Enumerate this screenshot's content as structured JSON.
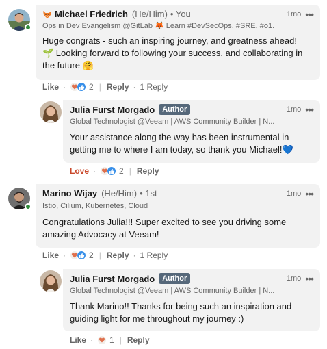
{
  "comments": [
    {
      "name": "Michael Friedrich",
      "pronouns": "(He/Him)",
      "connection": "• You",
      "headline": "Ops in Dev Evangelism @GitLab 🦊 Learn #DevSecOps, #SRE, #o1...",
      "time": "1mo",
      "text_line1": "Huge congrats - such an inspiring journey, and greatness ahead!",
      "text_line2": "🌱 Looking forward to following your success, and collaborating in",
      "text_line3": "the future 🤗",
      "action_like": "Like",
      "reaction_count": "2",
      "action_reply": "Reply",
      "replies": "1 Reply"
    },
    {
      "name": "Julia Furst Morgado",
      "badge": "Author",
      "headline": "Global Technologist @Veeam | AWS Community Builder | N...",
      "time": "1mo",
      "text_line1": "Your assistance along the way has been instrumental in",
      "text_line2": "getting me to where I am today, so thank you Michael!💙",
      "action_love": "Love",
      "reaction_count": "2",
      "action_reply": "Reply"
    },
    {
      "name": "Marino Wijay",
      "pronouns": "(He/Him)",
      "connection": "• 1st",
      "headline": "Istio, Cilium, Kubernetes, Cloud",
      "time": "1mo",
      "text_line1": "Congratulations Julia!!! Super excited to see you driving some",
      "text_line2": "amazing Advocacy at Veeam!",
      "action_like": "Like",
      "reaction_count": "2",
      "action_reply": "Reply",
      "replies": "1 Reply"
    },
    {
      "name": "Julia Furst Morgado",
      "badge": "Author",
      "headline": "Global Technologist @Veeam | AWS Community Builder | N...",
      "time": "1mo",
      "text_line1": "Thank Marino!! Thanks for being such an inspiration and",
      "text_line2": "guiding light for me throughout my journey :)",
      "action_like": "Like",
      "reaction_count": "1",
      "action_reply": "Reply"
    }
  ],
  "icons": {
    "more": "more-horizontal-icon",
    "heart": "heart-reaction-icon",
    "like": "like-reaction-icon",
    "fox": "fox-emoji-icon"
  },
  "colors": {
    "bubble": "#f2f2f2",
    "badge": "#56687a",
    "love": "#c9482b",
    "like_blue": "#378fe9",
    "heart_red": "#df704d",
    "online": "#2f8a3a"
  }
}
